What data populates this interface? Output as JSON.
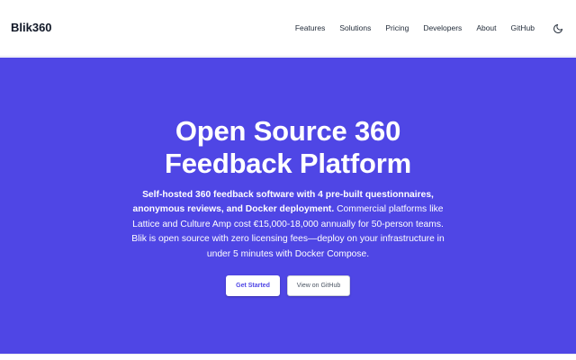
{
  "header": {
    "brand": "Blik360",
    "nav": [
      {
        "label": "Features"
      },
      {
        "label": "Solutions"
      },
      {
        "label": "Pricing"
      },
      {
        "label": "Developers"
      },
      {
        "label": "About"
      },
      {
        "label": "GitHub"
      }
    ],
    "theme_toggle_icon": "moon-icon"
  },
  "hero": {
    "title_line1": "Open Source 360",
    "title_line2": "Feedback Platform",
    "desc_bold": "Self-hosted 360 feedback software with 4 pre-built questionnaires, anonymous reviews, and Docker deployment.",
    "desc_rest": " Commercial platforms like Lattice and Culture Amp cost €15,000-18,000 annually for 50-person teams. Blik is open source with zero licensing fees—deploy on your infrastructure in under 5 minutes with Docker Compose.",
    "primary_button": "Get Started",
    "secondary_button": "View on GitHub"
  },
  "colors": {
    "hero_bg": "#4f46e5",
    "primary_text": "#4f46e5",
    "nav_text": "#1f2937"
  }
}
